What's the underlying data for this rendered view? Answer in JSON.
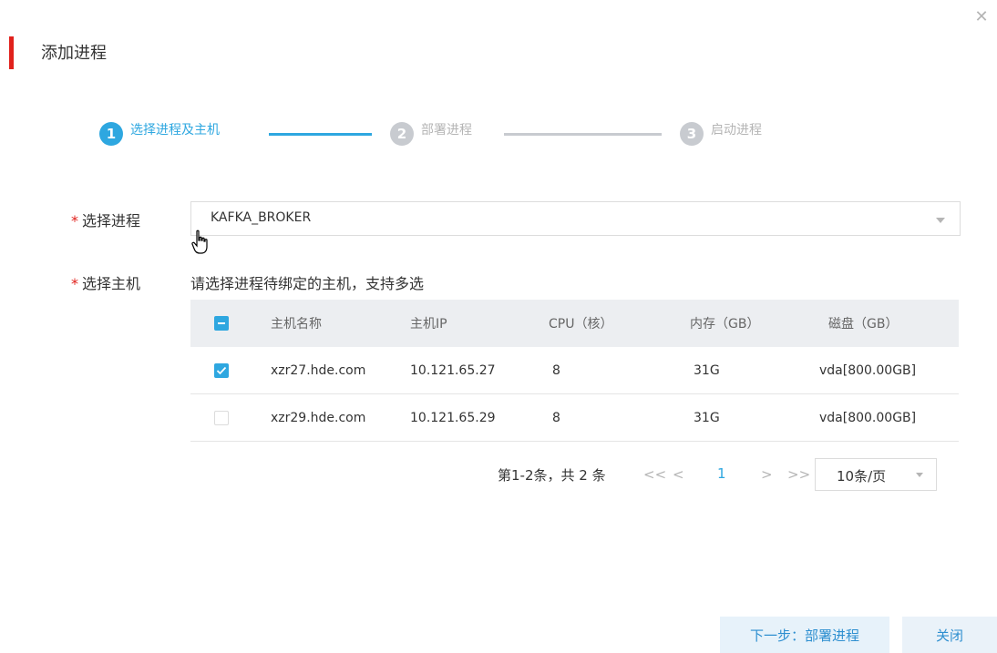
{
  "dialog": {
    "title": "添加进程",
    "close_icon": "close-icon"
  },
  "colors": {
    "accent": "#2ea7e0",
    "title_bar": "#e1211c",
    "inactive": "#c8cbd0"
  },
  "steps": [
    {
      "num": "1",
      "label": "选择进程及主机",
      "state": "active"
    },
    {
      "num": "2",
      "label": "部署进程",
      "state": "pending"
    },
    {
      "num": "3",
      "label": "启动进程",
      "state": "pending"
    }
  ],
  "form": {
    "required_mark": "*",
    "process_label": "选择进程",
    "process_value": "KAFKA_BROKER",
    "host_label": "选择主机",
    "host_hint": "请选择进程待绑定的主机，支持多选"
  },
  "table": {
    "headers": [
      "主机名称",
      "主机IP",
      "CPU（核）",
      "内存（GB）",
      "磁盘（GB）"
    ],
    "rows": [
      {
        "checked": true,
        "name": "xzr27.hde.com",
        "ip": "10.121.65.27",
        "cpu": "8",
        "mem": "31G",
        "disk": "vda[800.00GB]"
      },
      {
        "checked": false,
        "name": "xzr29.hde.com",
        "ip": "10.121.65.29",
        "cpu": "8",
        "mem": "31G",
        "disk": "vda[800.00GB]"
      }
    ]
  },
  "pagination": {
    "info": "第1-2条，共 2 条",
    "first": "<<",
    "prev": "<",
    "page": "1",
    "next": ">",
    "last": ">>",
    "page_size": "10条/页"
  },
  "footer": {
    "next_label": "下一步：部署进程",
    "close_label": "关闭"
  }
}
